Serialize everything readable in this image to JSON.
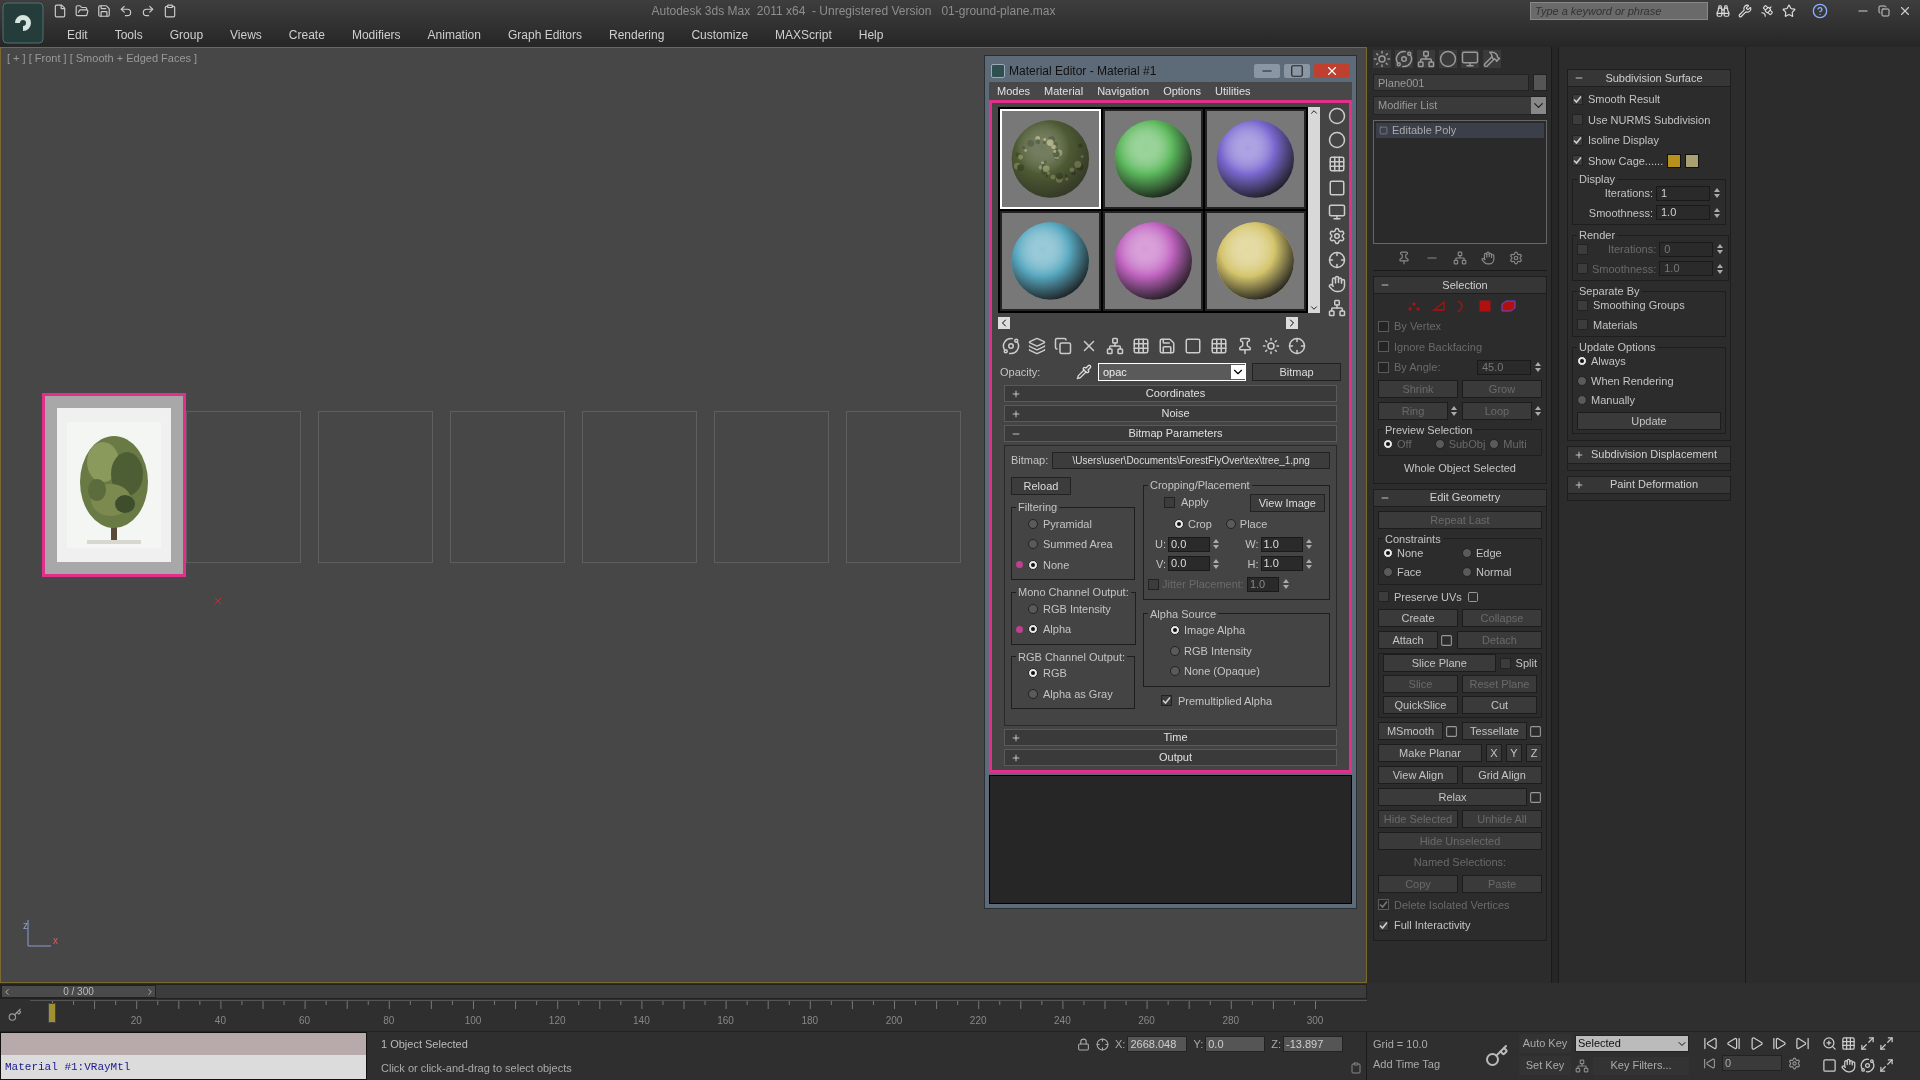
{
  "app": {
    "title": "Autodesk 3ds Max  2011 x64  - Unregistered Version   01-ground-plane.max",
    "search": {
      "placeholder": "Type a keyword or phrase"
    }
  },
  "menu": [
    "Edit",
    "Tools",
    "Group",
    "Views",
    "Create",
    "Modifiers",
    "Animation",
    "Graph Editors",
    "Rendering",
    "Customize",
    "MAXScript",
    "Help"
  ],
  "viewport": {
    "label": "[ + ] [ Front ] [ Smooth + Edged Faces ]",
    "axis_labels": [
      "z",
      "x"
    ],
    "slots": [
      {
        "kind": "picture",
        "selected": true
      },
      {
        "kind": "empty",
        "selected": false
      },
      {
        "kind": "empty",
        "selected": false
      },
      {
        "kind": "empty",
        "selected": false
      },
      {
        "kind": "empty",
        "selected": false
      },
      {
        "kind": "empty",
        "selected": false
      },
      {
        "kind": "empty",
        "selected": false
      }
    ]
  },
  "material_editor": {
    "title": "Material Editor - Material #1",
    "menu": [
      "Modes",
      "Material",
      "Navigation",
      "Options",
      "Utilities"
    ],
    "samples": [
      {
        "kind": "textured",
        "color": "#4e5a34",
        "selected": true
      },
      {
        "kind": "plain",
        "color": "#5cb85c",
        "selected": false
      },
      {
        "kind": "plain",
        "color": "#7a68d0",
        "selected": false
      },
      {
        "kind": "plain",
        "color": "#58a8c0",
        "selected": false
      },
      {
        "kind": "plain",
        "color": "#c064c0",
        "selected": false
      },
      {
        "kind": "plain",
        "color": "#d4c46c",
        "selected": false
      }
    ],
    "map_label": "Opacity:",
    "map_name": "opac",
    "map_type": "Bitmap",
    "rollouts": [
      {
        "title": "Coordinates",
        "expanded": false
      },
      {
        "title": "Noise",
        "expanded": false
      },
      {
        "title": "Bitmap Parameters",
        "expanded": true
      },
      {
        "title": "Time",
        "expanded": false
      },
      {
        "title": "Output",
        "expanded": false
      }
    ],
    "bitmap": {
      "label": "Bitmap:",
      "path": "\\Users\\user\\Documents\\ForestFlyOver\\tex\\tree_1.png",
      "reload": "Reload",
      "filtering": {
        "title": "Filtering",
        "options": [
          {
            "label": "Pyramidal",
            "selected": false,
            "changed": false
          },
          {
            "label": "Summed Area",
            "selected": false,
            "changed": false
          },
          {
            "label": "None",
            "selected": true,
            "changed": true
          }
        ]
      },
      "mono": {
        "title": "Mono Channel Output:",
        "options": [
          {
            "label": "RGB Intensity",
            "selected": false,
            "changed": false
          },
          {
            "label": "Alpha",
            "selected": true,
            "changed": true
          }
        ]
      },
      "rgb": {
        "title": "RGB Channel Output:",
        "options": [
          {
            "label": "RGB",
            "selected": true,
            "changed": false
          },
          {
            "label": "Alpha as Gray",
            "selected": false,
            "changed": false
          }
        ]
      },
      "cropping": {
        "title": "Cropping/Placement",
        "apply": {
          "label": "Apply",
          "checked": false
        },
        "view_image": "View Image",
        "modes": [
          {
            "label": "Crop",
            "selected": true
          },
          {
            "label": "Place",
            "selected": false
          }
        ],
        "fields": [
          {
            "label": "U:",
            "value": "0.0"
          },
          {
            "label": "W:",
            "value": "1.0"
          },
          {
            "label": "V:",
            "value": "0.0"
          },
          {
            "label": "H:",
            "value": "1.0"
          }
        ],
        "jitter": {
          "label": "Jitter Placement:",
          "checked": false,
          "value": "1.0"
        }
      },
      "alpha_source": {
        "title": "Alpha Source",
        "options": [
          {
            "label": "Image Alpha",
            "selected": true
          },
          {
            "label": "RGB Intensity",
            "selected": false
          },
          {
            "label": "None (Opaque)",
            "selected": false
          }
        ]
      },
      "premultiplied": {
        "label": "Premultiplied Alpha",
        "checked": true
      }
    }
  },
  "command_panel": {
    "object_name": "Plane001",
    "modifier_list": "Modifier List",
    "stack": [
      {
        "label": "Editable Poly",
        "selected": true
      }
    ],
    "left_rollouts": [
      {
        "title": "Selection",
        "expanded": true,
        "rows": [
          [
            {
              "kind": "subobject_icons"
            }
          ],
          [
            {
              "kind": "checkbox",
              "label": "By Vertex",
              "checked": false,
              "disabled": true
            }
          ],
          [
            {
              "kind": "checkbox",
              "label": "Ignore Backfacing",
              "checked": false,
              "disabled": true
            }
          ],
          [
            {
              "kind": "checkbox",
              "label": "By Angle:",
              "checked": false,
              "disabled": true
            },
            {
              "kind": "spinner",
              "value": "45.0",
              "disabled": true
            }
          ],
          [
            {
              "kind": "button",
              "label": "Shrink",
              "disabled": true
            },
            {
              "kind": "button",
              "label": "Grow",
              "disabled": true
            }
          ],
          [
            {
              "kind": "step_button",
              "label": "Ring",
              "disabled": true
            },
            {
              "kind": "step_button",
              "label": "Loop",
              "disabled": true
            }
          ],
          [
            {
              "kind": "group",
              "title": "Preview Selection",
              "rows": [
                [
                  {
                    "kind": "radio",
                    "label": "Off",
                    "selected": true,
                    "disabled": true
                  },
                  {
                    "kind": "radio",
                    "label": "SubObj",
                    "selected": false,
                    "disabled": true
                  },
                  {
                    "kind": "radio",
                    "label": "Multi",
                    "selected": false,
                    "disabled": true
                  }
                ]
              ]
            }
          ],
          [
            {
              "kind": "text",
              "label": "Whole Object Selected",
              "disabled": false
            }
          ]
        ]
      },
      {
        "title": "Edit Geometry",
        "expanded": true,
        "rows": [
          [
            {
              "kind": "button",
              "label": "Repeat Last",
              "disabled": true
            }
          ],
          [
            {
              "kind": "group",
              "title": "Constraints",
              "rows": [
                [
                  {
                    "kind": "radio",
                    "label": "None",
                    "selected": true,
                    "disabled": false
                  },
                  {
                    "kind": "radio",
                    "label": "Edge",
                    "selected": false,
                    "disabled": false
                  }
                ],
                [
                  {
                    "kind": "radio",
                    "label": "Face",
                    "selected": false,
                    "disabled": false
                  },
                  {
                    "kind": "radio",
                    "label": "Normal",
                    "selected": false,
                    "disabled": false
                  }
                ]
              ]
            }
          ],
          [
            {
              "kind": "settings_checkbox",
              "label": "Preserve UVs",
              "checked": false,
              "disabled": false
            }
          ],
          [
            {
              "kind": "button",
              "label": "Create",
              "disabled": false
            },
            {
              "kind": "button",
              "label": "Collapse",
              "disabled": true
            }
          ],
          [
            {
              "kind": "settings_button",
              "label": "Attach",
              "disabled": false
            },
            {
              "kind": "button",
              "label": "Detach",
              "disabled": true
            }
          ],
          [
            {
              "kind": "group",
              "rows": [
                [
                  {
                    "kind": "button",
                    "label": "Slice Plane",
                    "disabled": false
                  },
                  {
                    "kind": "checkbox",
                    "label": "Split",
                    "checked": false,
                    "disabled": false
                  }
                ],
                [
                  {
                    "kind": "button",
                    "label": "Slice",
                    "disabled": true
                  },
                  {
                    "kind": "button",
                    "label": "Reset Plane",
                    "disabled": true
                  }
                ],
                [
                  {
                    "kind": "button",
                    "label": "QuickSlice",
                    "disabled": false
                  },
                  {
                    "kind": "button",
                    "label": "Cut",
                    "disabled": false
                  }
                ]
              ]
            }
          ],
          [
            {
              "kind": "settings_button",
              "label": "MSmooth",
              "disabled": false
            },
            {
              "kind": "settings_button",
              "label": "Tessellate",
              "disabled": false
            }
          ],
          [
            {
              "kind": "button",
              "label": "Make Planar",
              "disabled": false
            },
            {
              "kind": "small_button",
              "label": "X",
              "disabled": false
            },
            {
              "kind": "small_button",
              "label": "Y",
              "disabled": false
            },
            {
              "kind": "small_button",
              "label": "Z",
              "disabled": false
            }
          ],
          [
            {
              "kind": "button",
              "label": "View Align",
              "disabled": false
            },
            {
              "kind": "button",
              "label": "Grid Align",
              "disabled": false
            }
          ],
          [
            {
              "kind": "settings_button",
              "label": "Relax",
              "disabled": false
            }
          ],
          [
            {
              "kind": "button",
              "label": "Hide Selected",
              "disabled": true
            },
            {
              "kind": "button",
              "label": "Unhide All",
              "disabled": true
            }
          ],
          [
            {
              "kind": "button",
              "label": "Hide Unselected",
              "disabled": true
            }
          ],
          [
            {
              "kind": "text",
              "label": "Named Selections:",
              "disabled": true
            }
          ],
          [
            {
              "kind": "button",
              "label": "Copy",
              "disabled": true
            },
            {
              "kind": "button",
              "label": "Paste",
              "disabled": true
            }
          ],
          [
            {
              "kind": "checkbox",
              "label": "Delete Isolated Vertices",
              "checked": true,
              "disabled": true
            }
          ],
          [
            {
              "kind": "checkbox",
              "label": "Full Interactivity",
              "checked": true,
              "disabled": false
            }
          ]
        ]
      }
    ],
    "right_rollouts": [
      {
        "title": "Subdivision Surface",
        "expanded": true,
        "rows": [
          [
            {
              "kind": "checkbox",
              "label": "Smooth Result",
              "checked": true,
              "disabled": false
            }
          ],
          [
            {
              "kind": "checkbox",
              "label": "Use NURMS Subdivision",
              "checked": false,
              "disabled": false
            }
          ],
          [
            {
              "kind": "checkbox",
              "label": "Isoline Display",
              "checked": true,
              "disabled": false
            }
          ],
          [
            {
              "kind": "checkbox",
              "label": "Show Cage......",
              "checked": true,
              "disabled": false
            },
            {
              "kind": "swatch",
              "color": "#b8901c"
            },
            {
              "kind": "swatch",
              "color": "#a8a070"
            }
          ],
          [
            {
              "kind": "group",
              "title": "Display",
              "rows": [
                [
                  {
                    "kind": "spinner",
                    "label": "Iterations:",
                    "value": "1",
                    "disabled": false
                  }
                ],
                [
                  {
                    "kind": "spinner",
                    "label": "Smoothness:",
                    "value": "1.0",
                    "disabled": false
                  }
                ]
              ]
            }
          ],
          [
            {
              "kind": "group",
              "title": "Render",
              "rows": [
                [
                  {
                    "kind": "checkbox",
                    "checked": false,
                    "disabled": false
                  },
                  {
                    "kind": "spinner",
                    "label": "Iterations:",
                    "value": "0",
                    "disabled": true
                  }
                ],
                [
                  {
                    "kind": "checkbox",
                    "checked": false,
                    "disabled": false
                  },
                  {
                    "kind": "spinner",
                    "label": "Smoothness:",
                    "value": "1.0",
                    "disabled": true
                  }
                ]
              ]
            }
          ],
          [
            {
              "kind": "group",
              "title": "Separate By",
              "rows": [
                [
                  {
                    "kind": "checkbox",
                    "label": "Smoothing Groups",
                    "checked": false,
                    "disabled": false
                  }
                ],
                [
                  {
                    "kind": "checkbox",
                    "label": "Materials",
                    "checked": false,
                    "disabled": false
                  }
                ]
              ]
            }
          ],
          [
            {
              "kind": "group",
              "title": "Update Options",
              "rows": [
                [
                  {
                    "kind": "radio",
                    "label": "Always",
                    "selected": true,
                    "disabled": false
                  }
                ],
                [
                  {
                    "kind": "radio",
                    "label": "When Rendering",
                    "selected": false,
                    "disabled": false
                  }
                ],
                [
                  {
                    "kind": "radio",
                    "label": "Manually",
                    "selected": false,
                    "disabled": false
                  }
                ],
                [
                  {
                    "kind": "button",
                    "label": "Update",
                    "disabled": false
                  }
                ]
              ]
            }
          ]
        ]
      },
      {
        "title": "Subdivision Displacement",
        "expanded": false
      },
      {
        "title": "Paint Deformation",
        "expanded": false
      }
    ]
  },
  "timeline": {
    "frame": "0 / 300",
    "level": 0,
    "ticks": [
      "20",
      "40",
      "60",
      "80",
      "100",
      "120",
      "140",
      "160",
      "180",
      "200",
      "220",
      "240",
      "260",
      "280",
      "300"
    ]
  },
  "status": {
    "listener": "Material #1:VRayMtl",
    "selection": "1 Object Selected",
    "prompt": "Click or click-and-drag to select objects",
    "coords": [
      {
        "label": "X:",
        "value": "2668.048"
      },
      {
        "label": "Y:",
        "value": "0.0"
      },
      {
        "label": "Z:",
        "value": "-13.897"
      }
    ],
    "grid": "Grid = 10.0",
    "time_tag": "Add Time Tag",
    "auto_key": "Auto Key",
    "key_mode": "Selected",
    "set_key": "Set Key",
    "key_filters": "Key Filters...",
    "frame": "0"
  }
}
